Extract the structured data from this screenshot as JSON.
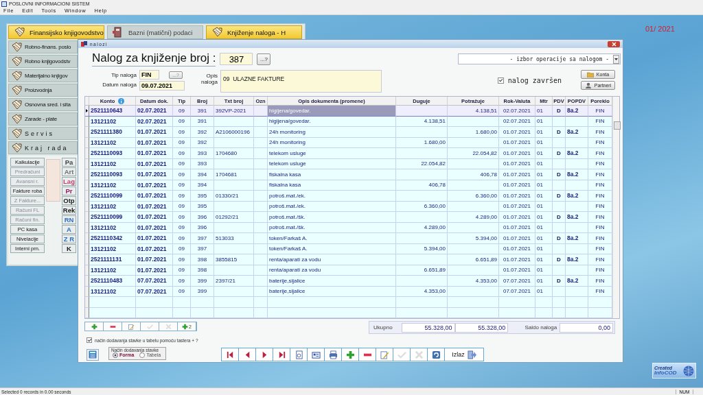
{
  "app": {
    "title": "POSLOVNI INFORMACIONI SISTEM",
    "menu": [
      "File",
      "Edit",
      "Tools",
      "Window",
      "Help"
    ]
  },
  "top_tabs": [
    {
      "label": "Finansijsko knjigovodstvo",
      "selected": true
    },
    {
      "label": "Bazni (matični) podaci",
      "selected": false
    },
    {
      "label": "Knjiženje naloga - H",
      "selected": true
    }
  ],
  "side_menu": [
    {
      "label": "Robno-finans. poslo",
      "kind": "normal"
    },
    {
      "label": "Robno knjigovodstv",
      "kind": "normal"
    },
    {
      "label": "Materijalno knjigov",
      "kind": "normal"
    },
    {
      "label": "Proizvodnja",
      "kind": "normal"
    },
    {
      "label": "Osnovna sred. i sita",
      "kind": "normal"
    },
    {
      "label": "Zarade - plate",
      "kind": "normal"
    },
    {
      "label": "Servis",
      "kind": "spaced"
    },
    {
      "label": "Kraj rada",
      "kind": "spaced"
    }
  ],
  "quick_buttons": {
    "column_1": [
      {
        "label": "Kalkulacije",
        "disabled": false
      },
      {
        "label": "Predračuni",
        "disabled": true
      },
      {
        "label": "Avansni r.",
        "disabled": true
      },
      {
        "label": "Fakture roba",
        "disabled": false
      },
      {
        "label": "Z Fakture...",
        "disabled": true
      },
      {
        "label": "Računi FL",
        "disabled": true
      },
      {
        "label": "Računi fin.",
        "disabled": true
      },
      {
        "label": "PC kasa",
        "disabled": false
      },
      {
        "label": "Nivelacije",
        "disabled": false
      },
      {
        "label": "Interni prn.",
        "disabled": false
      }
    ],
    "column_2": [
      {
        "label": "Pa",
        "color": "#404040"
      },
      {
        "label": "Art",
        "color": "#707070"
      },
      {
        "label": "Lag",
        "color": "#c04070"
      },
      {
        "label": "Pr",
        "color": "#902060"
      },
      {
        "label": "Otp",
        "color": "#202020"
      },
      {
        "label": "Rek",
        "color": "#202020"
      },
      {
        "label": "RN",
        "color": "#3070c0"
      },
      {
        "label": "A",
        "color": "#3070c0"
      },
      {
        "label": "Z R",
        "color": "#3070c0"
      },
      {
        "label": "K",
        "color": "#202020"
      }
    ]
  },
  "period": "01/ 2021",
  "dialog": {
    "title": "nalozi",
    "heading": "Nalog za knjiženje broj :",
    "number": "387",
    "lookup_button": "...?",
    "operation_select": "- izbor operacije sa nalogom -",
    "tip_label": "Tip naloga",
    "tip_value": "FIN",
    "tip_button": {
      "label": "...?",
      "disabled": true
    },
    "datum_label": "Datum naloga",
    "datum_value": "09.07.2021",
    "opis_label": "Opis naloga",
    "opis_value": "09  ULAZNE FAKTURE",
    "completed": {
      "label": "nalog završen",
      "checked": true
    },
    "side_buttons": [
      "Konta",
      "Partneri"
    ],
    "table": {
      "columns": [
        "Konto",
        "Datum dok.",
        "Tip",
        "Broj",
        "Txt broj",
        "Ozn",
        "Opis dokumenta (promene)",
        "Duguje",
        "Potražuje",
        "Rok-Valuta",
        "Mtr",
        "PDV",
        "POPDV",
        "Poreklo"
      ],
      "rows": [
        {
          "konto": "2521110643",
          "datum": "02.07.2021",
          "tip": "09",
          "broj": "391",
          "txt_broj": "392VP-2021",
          "opis": "higijena/govedar.",
          "potrazuje": "4.138,51",
          "rok_valuta": "02.07.2021",
          "mtr": "01",
          "pdv": "D",
          "popdv": "8a.2",
          "poreklo": "FIN",
          "selected": true
        },
        {
          "konto": "13121102",
          "datum": "02.07.2021",
          "tip": "09",
          "broj": "391",
          "opis": "higijena/govedar.",
          "duguje": "4.138,51",
          "rok_valuta": "02.07.2021",
          "mtr": "01",
          "poreklo": "FIN",
          "selected": false
        },
        {
          "konto": "2521111380",
          "datum": "01.07.2021",
          "tip": "09",
          "broj": "392",
          "txt_broj": "A2106000196",
          "opis": "24h monitoring",
          "potrazuje": "1.680,00",
          "rok_valuta": "01.07.2021",
          "mtr": "01",
          "pdv": "D",
          "popdv": "8a.2",
          "poreklo": "FIN",
          "selected": false
        },
        {
          "konto": "13121102",
          "datum": "01.07.2021",
          "tip": "09",
          "broj": "392",
          "opis": "24h monitoring",
          "duguje": "1.680,00",
          "rok_valuta": "01.07.2021",
          "mtr": "01",
          "poreklo": "FIN",
          "selected": false
        },
        {
          "konto": "2521110093",
          "datum": "01.07.2021",
          "tip": "09",
          "broj": "393",
          "txt_broj": "1704680",
          "opis": "telekom usluge",
          "potrazuje": "22.054,82",
          "rok_valuta": "01.07.2021",
          "mtr": "01",
          "pdv": "D",
          "popdv": "8a.2",
          "poreklo": "FIN",
          "selected": false
        },
        {
          "konto": "13121102",
          "datum": "01.07.2021",
          "tip": "09",
          "broj": "393",
          "opis": "telekom usluge",
          "duguje": "22.054,82",
          "rok_valuta": "01.07.2021",
          "mtr": "01",
          "poreklo": "FIN",
          "selected": false
        },
        {
          "konto": "2521110093",
          "datum": "01.07.2021",
          "tip": "09",
          "broj": "394",
          "txt_broj": "1704681",
          "opis": "fiskalna kasa",
          "potrazuje": "406,78",
          "rok_valuta": "01.07.2021",
          "mtr": "01",
          "pdv": "D",
          "popdv": "8a.2",
          "poreklo": "FIN",
          "selected": false
        },
        {
          "konto": "13121102",
          "datum": "01.07.2021",
          "tip": "09",
          "broj": "394",
          "opis": "fiskalna kasa",
          "duguje": "406,78",
          "rok_valuta": "01.07.2021",
          "mtr": "01",
          "poreklo": "FIN",
          "selected": false
        },
        {
          "konto": "2521110099",
          "datum": "01.07.2021",
          "tip": "09",
          "broj": "395",
          "txt_broj": "01330/21",
          "opis": "potroš.mat./ek.",
          "potrazuje": "6.360,00",
          "rok_valuta": "01.07.2021",
          "mtr": "01",
          "pdv": "D",
          "popdv": "8a.2",
          "poreklo": "FIN",
          "selected": false
        },
        {
          "konto": "13121102",
          "datum": "01.07.2021",
          "tip": "09",
          "broj": "395",
          "opis": "potroš.mat./ek.",
          "duguje": "6.360,00",
          "rok_valuta": "01.07.2021",
          "mtr": "01",
          "poreklo": "FIN",
          "selected": false
        },
        {
          "konto": "2521110099",
          "datum": "01.07.2021",
          "tip": "09",
          "broj": "396",
          "txt_broj": "01292/21",
          "opis": "potroš.mat./šk.",
          "potrazuje": "4.289,00",
          "rok_valuta": "01.07.2021",
          "mtr": "01",
          "pdv": "D",
          "popdv": "8a.2",
          "poreklo": "FIN",
          "selected": false
        },
        {
          "konto": "13121102",
          "datum": "01.07.2021",
          "tip": "09",
          "broj": "396",
          "opis": "potroš.mat./šk.",
          "duguje": "4.289,00",
          "rok_valuta": "01.07.2021",
          "mtr": "01",
          "poreklo": "FIN",
          "selected": false
        },
        {
          "konto": "2521110342",
          "datum": "01.07.2021",
          "tip": "09",
          "broj": "397",
          "txt_broj": "513033",
          "opis": "token/Farkaš A.",
          "potrazuje": "5.394,00",
          "rok_valuta": "01.07.2021",
          "mtr": "01",
          "pdv": "D",
          "popdv": "8a.2",
          "poreklo": "FIN",
          "selected": false
        },
        {
          "konto": "13121102",
          "datum": "01.07.2021",
          "tip": "09",
          "broj": "397",
          "opis": "token/Farkaš A.",
          "duguje": "5.394,00",
          "rok_valuta": "01.07.2021",
          "mtr": "01",
          "poreklo": "FIN",
          "selected": false
        },
        {
          "konto": "2521111131",
          "datum": "01.07.2021",
          "tip": "09",
          "broj": "398",
          "txt_broj": "3855815",
          "opis": "renta/aparati za vodu",
          "potrazuje": "6.651,89",
          "rok_valuta": "01.07.2021",
          "mtr": "01",
          "pdv": "D",
          "popdv": "8a.2",
          "poreklo": "FIN",
          "selected": false
        },
        {
          "konto": "13121102",
          "datum": "01.07.2021",
          "tip": "09",
          "broj": "398",
          "opis": "renta/aparati za vodu",
          "duguje": "6.651,89",
          "rok_valuta": "01.07.2021",
          "mtr": "01",
          "poreklo": "FIN",
          "selected": false
        },
        {
          "konto": "2521110483",
          "datum": "07.07.2021",
          "tip": "09",
          "broj": "399",
          "txt_broj": "2397/21",
          "opis": "baterije,sijalice",
          "potrazuje": "4.353,00",
          "rok_valuta": "07.07.2021",
          "mtr": "01",
          "pdv": "D",
          "popdv": "8a.2",
          "poreklo": "FIN",
          "selected": false
        },
        {
          "konto": "13121102",
          "datum": "07.07.2021",
          "tip": "09",
          "broj": "399",
          "opis": "baterije,sijalice",
          "duguje": "4.353,00",
          "rok_valuta": "07.07.2021",
          "mtr": "01",
          "poreklo": "FIN",
          "selected": false
        }
      ]
    },
    "toolbar": [
      {
        "kind": "add",
        "disabled": false
      },
      {
        "kind": "remove",
        "disabled": false
      },
      {
        "kind": "edit",
        "disabled": false
      },
      {
        "kind": "confirm",
        "disabled": true
      },
      {
        "kind": "cancel",
        "disabled": true
      },
      {
        "kind": "add",
        "label": "2",
        "disabled": false
      }
    ],
    "totals": {
      "label": "Ukupno",
      "duguje": "55.328,00",
      "potrazuje": "55.328,00",
      "saldo_label": "Saldo naloga",
      "saldo": "0,00"
    },
    "add_by_key": {
      "label": "način dodavanja stavke u tabelu pomoću tastera + ?",
      "checked": true
    },
    "add_mode": {
      "title": "Način dodavanja stavke",
      "options": [
        {
          "label": "Forma",
          "selected": true
        },
        {
          "label": "Tabela",
          "selected": false
        }
      ]
    },
    "nav_toolbar": [
      {
        "kind": "first",
        "disabled": false
      },
      {
        "kind": "prev",
        "disabled": false
      },
      {
        "kind": "next",
        "disabled": false
      },
      {
        "kind": "last",
        "disabled": false
      },
      {
        "kind": "preview",
        "disabled": false
      },
      {
        "kind": "form",
        "disabled": false
      },
      {
        "kind": "print",
        "disabled": false
      },
      {
        "kind": "add",
        "disabled": false
      },
      {
        "kind": "remove",
        "disabled": false
      },
      {
        "kind": "edit",
        "disabled": false
      },
      {
        "kind": "confirm",
        "disabled": true
      },
      {
        "kind": "cancel",
        "disabled": true
      },
      {
        "kind": "refresh",
        "disabled": false
      },
      {
        "kind": "exit",
        "label": "Izlaz",
        "disabled": false
      }
    ]
  },
  "status_bar": {
    "message": "Selected 0 records in 0.00 seconds",
    "num": "NUM"
  },
  "logo": {
    "line_1": "Created",
    "line_2": "InfoCOD"
  }
}
